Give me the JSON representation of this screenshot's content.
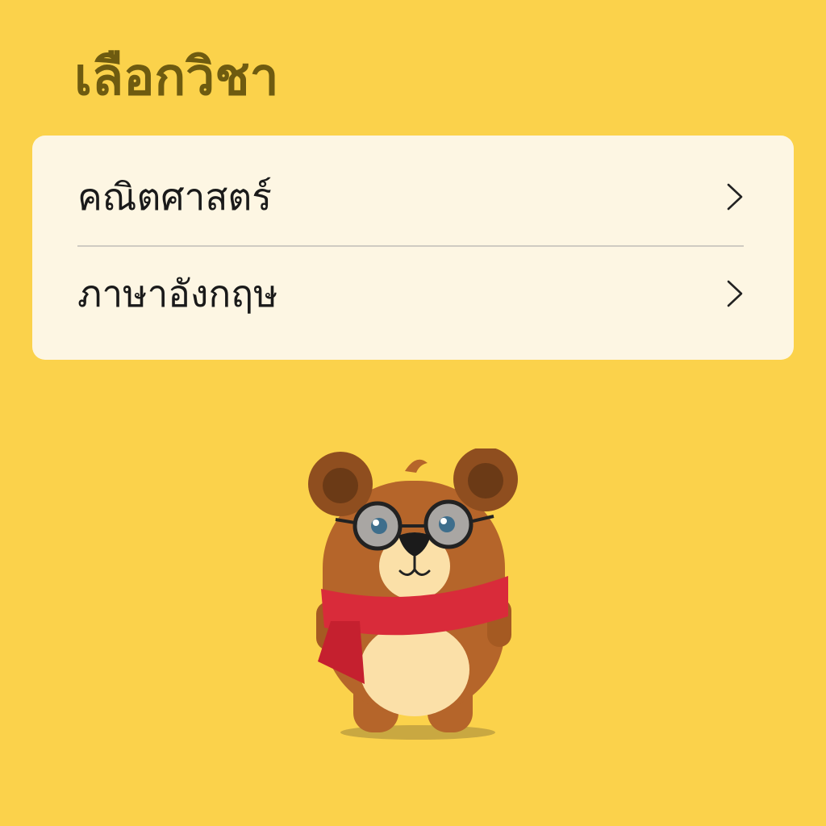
{
  "header": {
    "title": "เลือกวิชา"
  },
  "subjects": {
    "items": [
      {
        "label": "คณิตศาสตร์",
        "icon": "chevron-right-icon"
      },
      {
        "label": "ภาษาอังกฤษ",
        "icon": "chevron-right-icon"
      }
    ]
  },
  "mascot": {
    "icon": "bear-mascot-icon"
  },
  "colors": {
    "background": "#FBD24B",
    "title": "#6E5B10",
    "card": "#FDF6E3",
    "scarf": "#D92B3A",
    "bear_fur": "#B5652A"
  }
}
